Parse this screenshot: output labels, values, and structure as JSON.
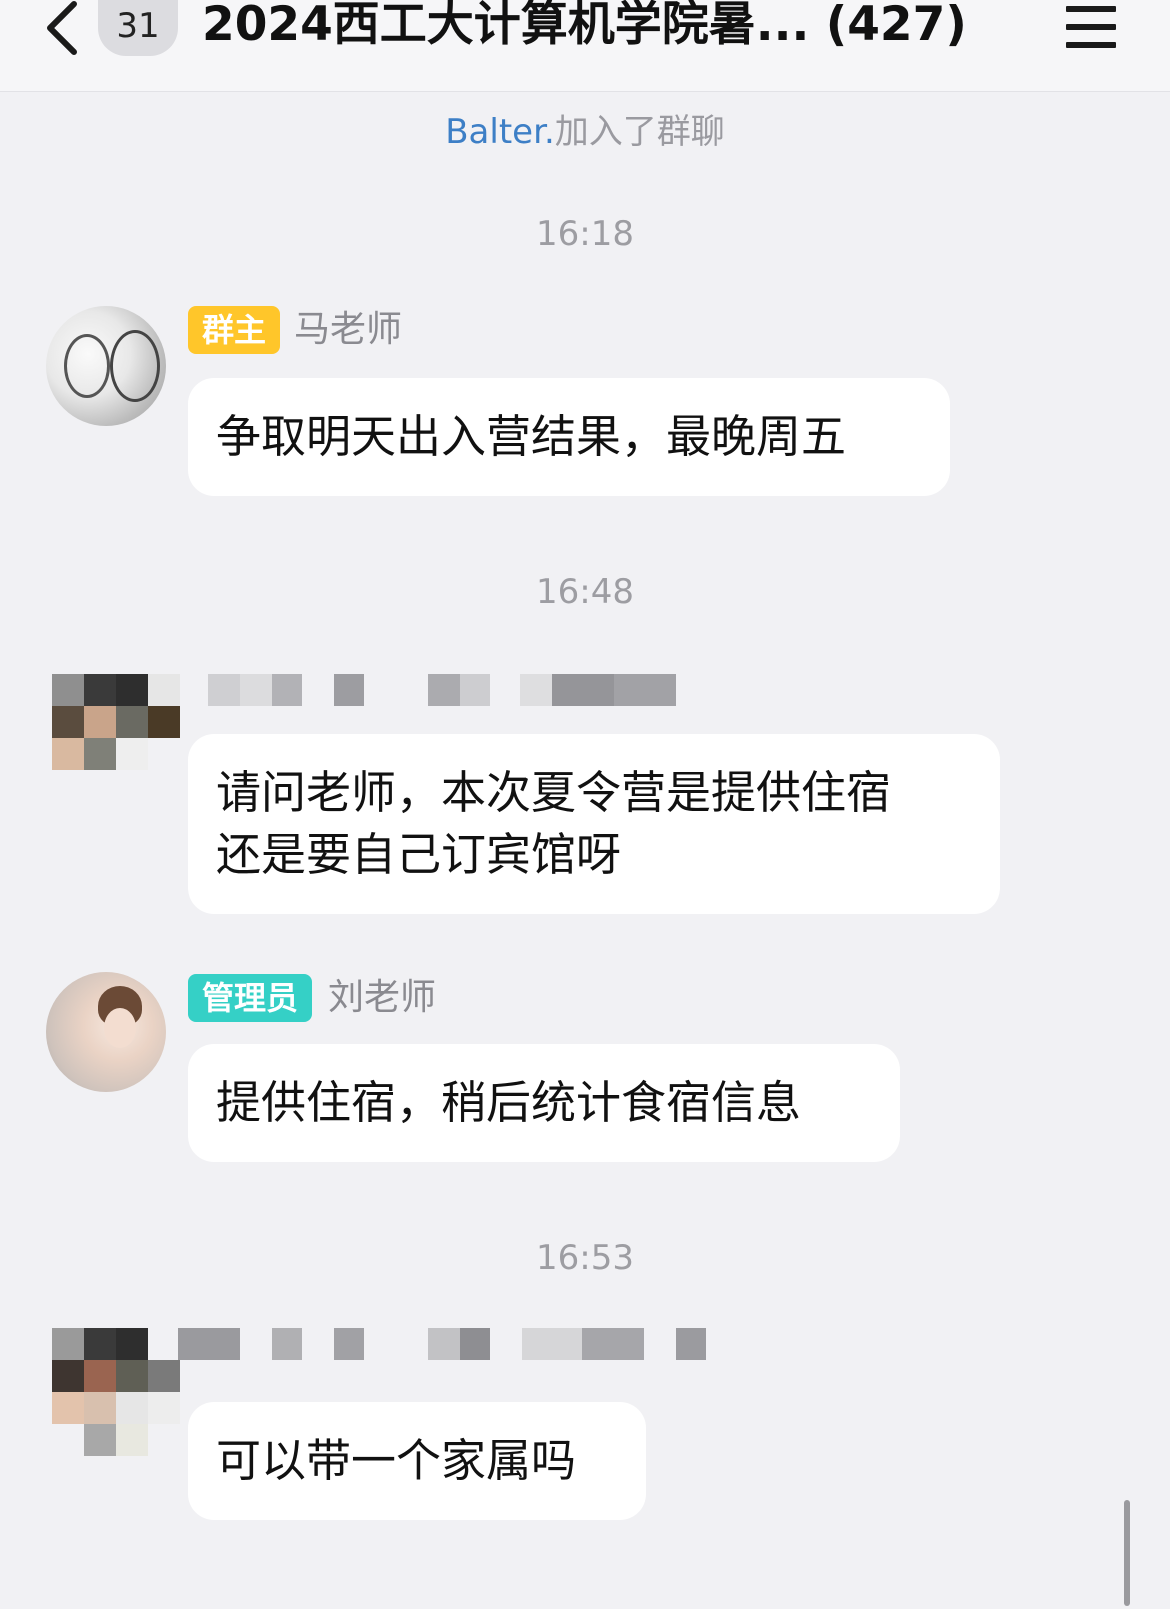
{
  "header": {
    "unread_count": "31",
    "title": "2024西工大计算机学院暑... (427)",
    "back_icon": "chevron-left-icon",
    "menu_icon": "hamburger-menu-icon"
  },
  "system_message": {
    "name": "Balter.",
    "text": "加入了群聊"
  },
  "messages": [
    {
      "time": "16:18",
      "role": "群主",
      "sender": "马老师",
      "text": "争取明天出入营结果，最晚周五"
    },
    {
      "time": "16:48",
      "role": "",
      "sender": "",
      "text": "请问老师，本次夏令营是提供住宿\n还是要自己订宾馆呀"
    },
    {
      "time": "",
      "role": "管理员",
      "sender": "刘老师",
      "text": "提供住宿，稍后统计食宿信息"
    },
    {
      "time": "16:53",
      "role": "",
      "sender": "",
      "text": "可以带一个家属吗"
    }
  ],
  "colors": {
    "owner_tag": "#ffc62a",
    "admin_tag": "#35d0c6",
    "system_name": "#3d7fc6",
    "background": "#f1f1f4"
  }
}
